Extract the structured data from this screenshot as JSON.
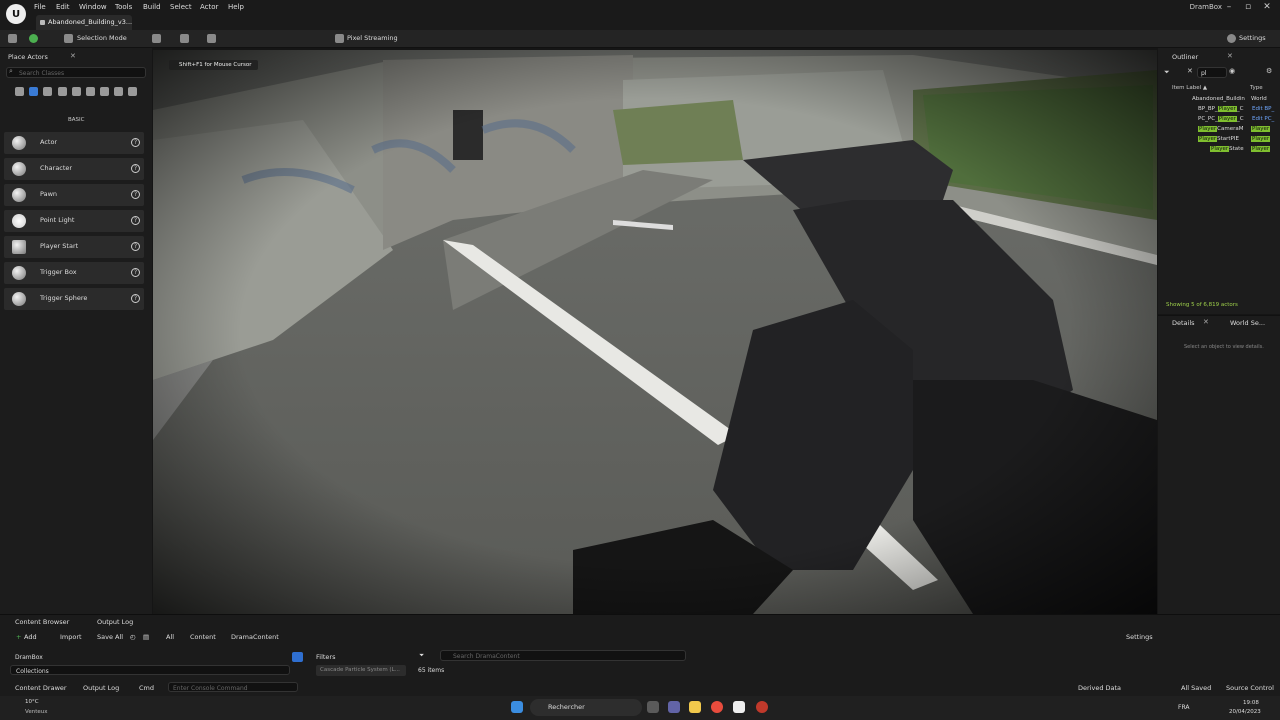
{
  "menubar": {
    "items": [
      "File",
      "Edit",
      "Window",
      "Tools",
      "Build",
      "Select",
      "Actor",
      "Help"
    ],
    "doc_tab": "Abandoned_Building_v3...",
    "app_name": "DramBox"
  },
  "toolbar": {
    "mode": "Selection Mode",
    "streaming": "Pixel Streaming",
    "settings": "Settings"
  },
  "place_actors": {
    "tab": "Place Actors",
    "search_placeholder": "Search Classes",
    "category": "BASIC",
    "items": [
      {
        "label": "Actor",
        "icon": "actor-icon"
      },
      {
        "label": "Character",
        "icon": "character-icon"
      },
      {
        "label": "Pawn",
        "icon": "pawn-icon"
      },
      {
        "label": "Point Light",
        "icon": "light-bulb-icon"
      },
      {
        "label": "Player Start",
        "icon": "flag-icon"
      },
      {
        "label": "Trigger Box",
        "icon": "cube-icon"
      },
      {
        "label": "Trigger Sphere",
        "icon": "sphere-icon"
      }
    ]
  },
  "viewport": {
    "hint": "Shift+F1 for Mouse Cursor"
  },
  "outliner": {
    "tab": "Outliner",
    "search_value": "pl",
    "col_label": "Item Label ▲",
    "col_type": "Type",
    "rows": [
      {
        "pre": "Abandoned_Buildin",
        "mid": "",
        "post": "",
        "type": "World"
      },
      {
        "pre": "BP_BP_",
        "mid": "Player",
        "post": "_C",
        "type": "Edit BP_"
      },
      {
        "pre": "PC_PC_",
        "mid": "Player",
        "post": "_C",
        "type": "Edit PC_"
      },
      {
        "pre": "",
        "mid": "Player",
        "post": "CameraM",
        "type": "Player"
      },
      {
        "pre": "",
        "mid": "Player",
        "post": "StartPIE",
        "type": "Player"
      },
      {
        "pre": "",
        "mid": "Player",
        "post": "State",
        "type": "Player"
      }
    ],
    "count": "Showing 5 of 6,819 actors"
  },
  "details": {
    "tab": "Details",
    "tab2": "World Se...",
    "empty": "Select an object to view details."
  },
  "bottom": {
    "tab_content": "Content Browser",
    "tab_log": "Output Log",
    "add": "Add",
    "import": "Import",
    "save_all": "Save All",
    "crumbs": [
      "All",
      "Content",
      "DramaContent"
    ],
    "settings": "Settings",
    "tree_root": "DramBox",
    "collections": "Collections",
    "filters": "Filters",
    "filter_chip": "Cascade Particle System (L...",
    "search_placeholder": "Search DramaContent",
    "items_count": "65 items",
    "drawer": "Content Drawer",
    "output_log": "Output Log",
    "cmd": "Cmd",
    "console_placeholder": "Enter Console Command",
    "derived": "Derived Data",
    "all_saved": "All Saved",
    "source_control": "Source Control"
  },
  "taskbar": {
    "temp": "10°C",
    "weather": "Venteux",
    "search": "Rechercher",
    "lang": "FRA",
    "time": "19:08",
    "date": "20/04/2023"
  }
}
